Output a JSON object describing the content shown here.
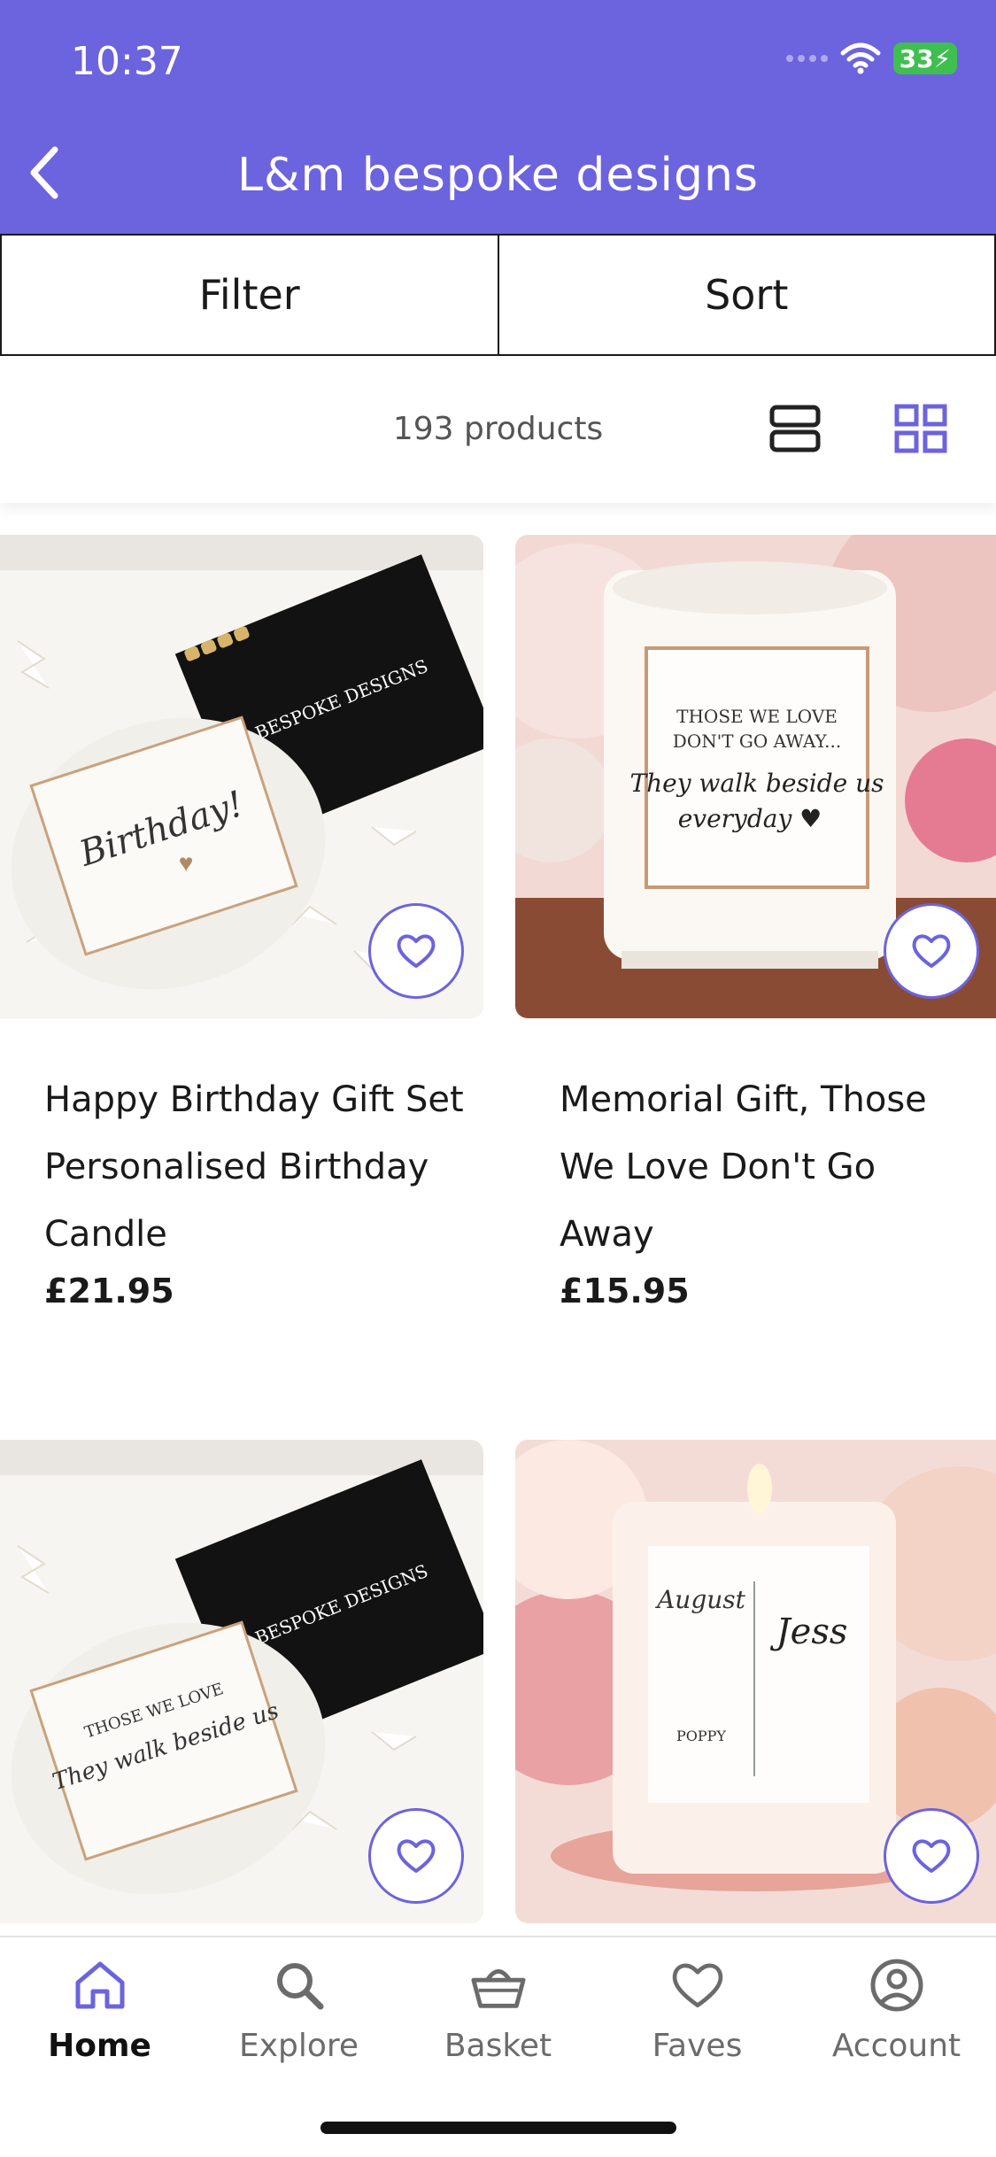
{
  "status_bar": {
    "time": "10:37",
    "battery": "33"
  },
  "header": {
    "title": "L&m bespoke designs"
  },
  "toolbar": {
    "filter_label": "Filter",
    "sort_label": "Sort"
  },
  "results": {
    "count_text": "193 products",
    "active_view": "grid"
  },
  "products": [
    {
      "title": "Happy Birthday Gift Set Personalised Birthday Candle",
      "price": "£21.95",
      "image": "birthday-candle-gift-set",
      "favorited": false
    },
    {
      "title": "Memorial Gift, Those We Love Don't Go Away",
      "price": "£15.95",
      "image": "memorial-candle",
      "favorited": false
    },
    {
      "title": "",
      "price": "",
      "image": "memorial-candle-gift-set",
      "favorited": false
    },
    {
      "title": "",
      "price": "",
      "image": "birth-flower-candle",
      "favorited": false
    }
  ],
  "nav": {
    "items": [
      {
        "label": "Home",
        "icon": "home-icon",
        "active": true
      },
      {
        "label": "Explore",
        "icon": "search-icon",
        "active": false
      },
      {
        "label": "Basket",
        "icon": "basket-icon",
        "active": false
      },
      {
        "label": "Faves",
        "icon": "heart-icon",
        "active": false
      },
      {
        "label": "Account",
        "icon": "account-icon",
        "active": false
      }
    ]
  },
  "colors": {
    "accent": "#6c63de",
    "battery": "#3fbf4f"
  }
}
